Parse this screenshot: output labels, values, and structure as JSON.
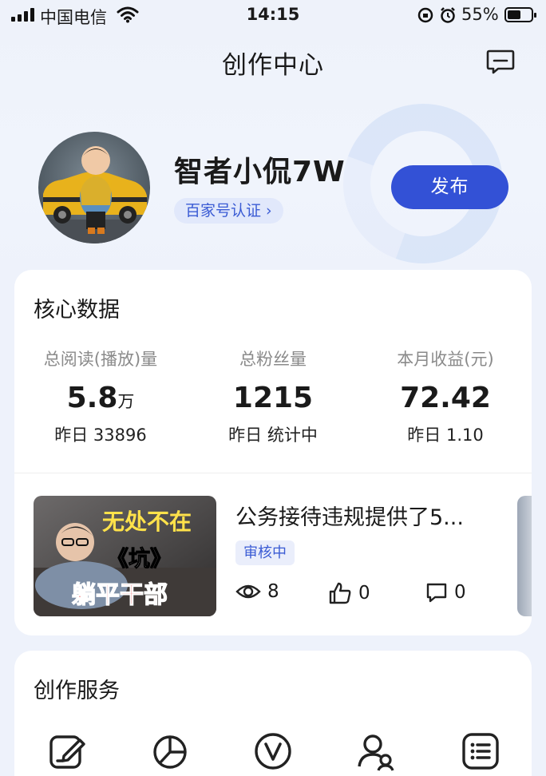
{
  "status_bar": {
    "carrier": "中国电信",
    "time": "14:15",
    "battery": "55%"
  },
  "nav": {
    "title": "创作中心",
    "message_icon": "chat-bubble-icon"
  },
  "profile": {
    "username": "智者小侃7W",
    "verification": "百家号认证 ›",
    "publish_button": "发布"
  },
  "core_data": {
    "title": "核心数据",
    "stats": [
      {
        "label": "总阅读(播放)量",
        "value": "5.8",
        "unit": "万",
        "sub": "昨日 33896"
      },
      {
        "label": "总粉丝量",
        "value": "1215",
        "unit": "",
        "sub": "昨日 统计中"
      },
      {
        "label": "本月收益(元)",
        "value": "72.42",
        "unit": "",
        "sub": "昨日 1.10"
      }
    ]
  },
  "article": {
    "thumb_text_1": "无处不在",
    "thumb_text_2": "《坑》",
    "thumb_text_3": "躺平干部",
    "title": "公务接待违规提供了5...",
    "status": "审核中",
    "views": "8",
    "likes": "0",
    "comments": "0"
  },
  "services": {
    "title": "创作服务",
    "icons": [
      "edit-icon",
      "pie-chart-icon",
      "v-badge-icon",
      "user-group-icon",
      "list-icon"
    ]
  },
  "colors": {
    "accent": "#3351d6",
    "badge_bg": "#e1e8fb",
    "page_bg": "#eef2fb"
  }
}
